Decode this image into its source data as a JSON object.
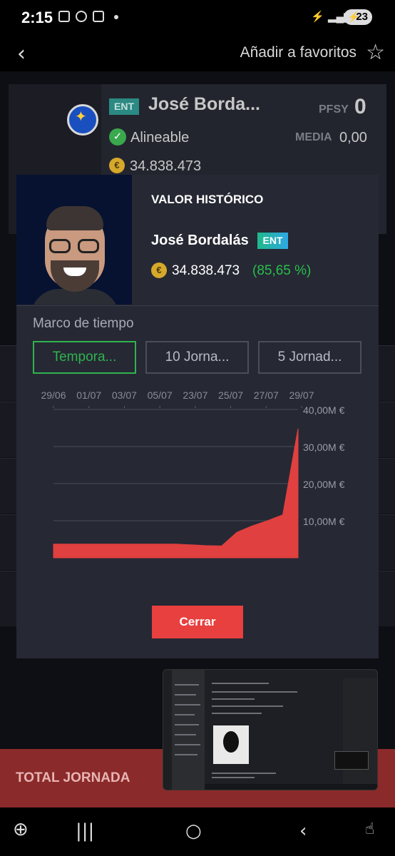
{
  "status_bar": {
    "time": "2:15",
    "battery": "23"
  },
  "topbar": {
    "favorite_label": "Añadir a favoritos"
  },
  "player_card": {
    "badge": "ENT",
    "name": "José Borda...",
    "pfsy_label": "PFSY",
    "pfsy_value": "0",
    "status": "Alineable",
    "media_label": "MEDIA",
    "media_value": "0,00",
    "market_value": "34.838.473"
  },
  "modal": {
    "title": "VALOR HISTÓRICO",
    "player_name": "José Bordalás",
    "badge": "ENT",
    "value": "34.838.473",
    "change": "(85,65 %)",
    "timeframe_label": "Marco de tiempo",
    "tabs": [
      "Tempora...",
      "10 Jorna...",
      "5 Jornad..."
    ],
    "active_tab": 0,
    "close_label": "Cerrar"
  },
  "total_label": "TOTAL JORNADA",
  "chart_data": {
    "type": "area",
    "x_tick_labels": [
      "29/06",
      "01/07",
      "03/07",
      "05/07",
      "23/07",
      "25/07",
      "27/07",
      "29/07"
    ],
    "y_tick_labels": [
      "40,00M €",
      "30,00M €",
      "20,00M €",
      "10,00M €"
    ],
    "ylim": [
      0,
      40000000
    ],
    "series": [
      {
        "color": "#e0403f",
        "values": [
          3700000,
          3700000,
          3700000,
          3700000,
          3700000,
          3700000,
          3700000,
          3700000,
          3700000,
          3500000,
          3300000,
          3200000,
          6900000,
          8600000,
          10000000,
          11600000,
          34838473
        ]
      }
    ],
    "grid": true
  }
}
